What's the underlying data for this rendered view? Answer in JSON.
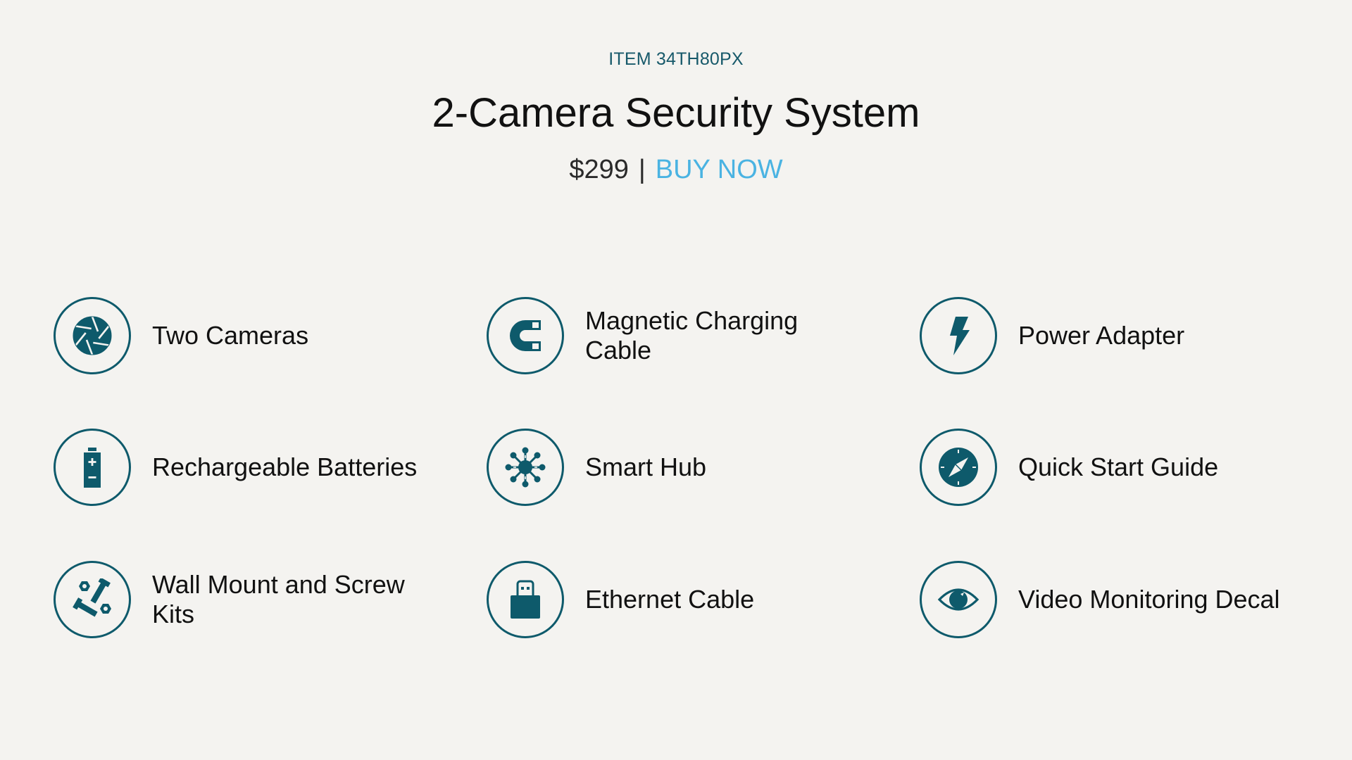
{
  "header": {
    "item_code": "ITEM 34TH80PX",
    "title": "2-Camera Security System",
    "price": "$299",
    "separator": "|",
    "buy_label": "BUY NOW"
  },
  "colors": {
    "accent": "#0e5a6b",
    "item_code": "#17596a",
    "buy_link": "#4ab3e2",
    "background": "#f4f3f0",
    "text": "#111111"
  },
  "features": [
    {
      "label": "Two Cameras",
      "icon": "camera-aperture-icon"
    },
    {
      "label": "Magnetic Charging Cable",
      "icon": "magnet-icon"
    },
    {
      "label": "Power Adapter",
      "icon": "lightning-bolt-icon"
    },
    {
      "label": "Rechargeable Batteries",
      "icon": "battery-icon"
    },
    {
      "label": "Smart Hub",
      "icon": "hub-network-icon"
    },
    {
      "label": "Quick Start Guide",
      "icon": "compass-icon"
    },
    {
      "label": "Wall Mount and Screw Kits",
      "icon": "screws-bolts-icon"
    },
    {
      "label": "Ethernet Cable",
      "icon": "usb-plug-icon"
    },
    {
      "label": "Video Monitoring Decal",
      "icon": "eye-icon"
    }
  ]
}
